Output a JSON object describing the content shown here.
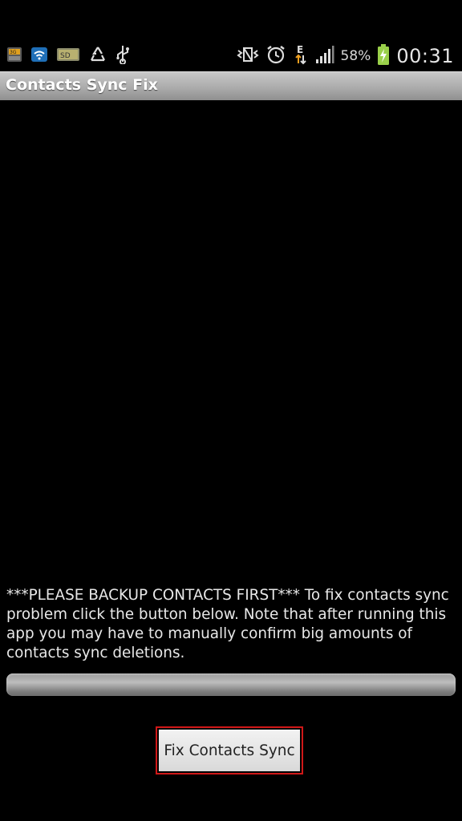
{
  "status_bar": {
    "battery_percent": "58%",
    "time": "00:31",
    "network_type": "E",
    "left_icons": [
      "3g-notification-icon",
      "wifi-notification-icon",
      "sd-card-icon",
      "recycle-icon",
      "usb-icon"
    ],
    "right_icons": [
      "vibrate-icon",
      "alarm-icon",
      "data-transfer-icon",
      "signal-icon",
      "battery-charging-icon"
    ]
  },
  "app": {
    "title": "Contacts Sync Fix"
  },
  "main": {
    "message": "***PLEASE BACKUP CONTACTS FIRST*** To fix contacts sync problem click the button below. Note that after running this app you may have to manually confirm big amounts of contacts sync deletions.",
    "progress": 0,
    "button_label": "Fix Contacts Sync"
  }
}
